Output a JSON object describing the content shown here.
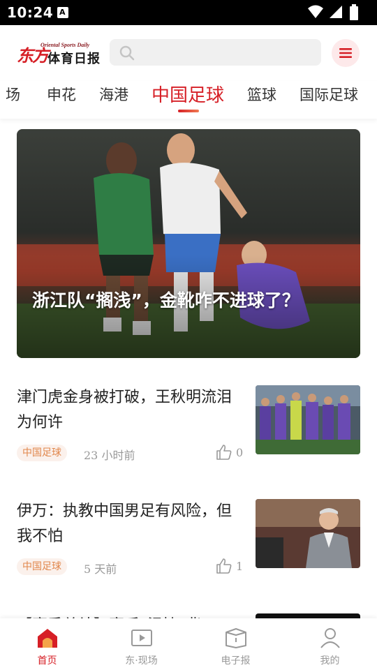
{
  "status_bar": {
    "time": "10:24",
    "notification_icon": "A"
  },
  "header": {
    "logo_mark": "东方",
    "logo_en": "Oriental Sports Daily",
    "logo_cn": "体育日报",
    "search_placeholder": "",
    "menu_icon": "hamburger-menu-icon"
  },
  "tabs": [
    {
      "label": "场"
    },
    {
      "label": "申花"
    },
    {
      "label": "海港"
    },
    {
      "label": "中国足球",
      "active": true
    },
    {
      "label": "篮球"
    },
    {
      "label": "国际足球"
    }
  ],
  "hero": {
    "title": "浙江队“搁浅”，金靴咋不进球了？"
  },
  "articles": [
    {
      "title": "津门虎金身被打破，王秋明流泪为何许",
      "tag": "中国足球",
      "time": "23 小时前",
      "likes": "0"
    },
    {
      "title": "伊万：执教中国男足有风险，但我不怕",
      "tag": "中国足球",
      "time": "5 天前",
      "likes": "1"
    },
    {
      "title": "【赛季总结】赛后“温情”背"
    }
  ],
  "bottom_nav": [
    {
      "label": "首页",
      "icon": "home-icon",
      "active": true
    },
    {
      "label": "东·现场",
      "icon": "video-play-icon"
    },
    {
      "label": "电子报",
      "icon": "newspaper-icon"
    },
    {
      "label": "我的",
      "icon": "profile-icon"
    }
  ],
  "colors": {
    "brand": "#d61f26",
    "tag_text": "#e1874c",
    "tag_bg": "#fbf1ec"
  }
}
